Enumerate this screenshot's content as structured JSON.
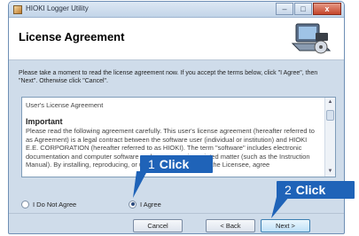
{
  "window": {
    "title": "HIOKI Logger Utility",
    "minimize": "–",
    "maximize": "□",
    "close": "x"
  },
  "header": {
    "title": "License Agreement"
  },
  "instructions": "Please take a moment to read the license agreement now. If you accept the terms below, click \"I Agree\", then \"Next\". Otherwise click \"Cancel\".",
  "license": {
    "heading": "User's License Agreement",
    "subheading": "Important",
    "body": "Please read the following agreement carefully. This user's license agreement (hereafter referred to as Agreement) is a legal contract between the software user (individual or institution) and HIOKI E.E. CORPORATION (hereafter referred to as HIOKI). The term \"software\" includes electronic documentation and computer software and accompanying printed matter (such as the Instruction Manual). By installing, reproducing, or using the software, you, the Licensee, agree"
  },
  "radio": {
    "disagree_label": "I Do Not Agree",
    "agree_label": "I Agree",
    "selected": "agree"
  },
  "buttons": {
    "cancel": "Cancel",
    "back": "< Back",
    "next": "Next >"
  },
  "callouts": {
    "one": {
      "number": "1",
      "label": "Click"
    },
    "two": {
      "number": "2",
      "label": "Click"
    }
  },
  "colors": {
    "callout": "#1f63b8",
    "window_border": "#6e8fb5"
  }
}
